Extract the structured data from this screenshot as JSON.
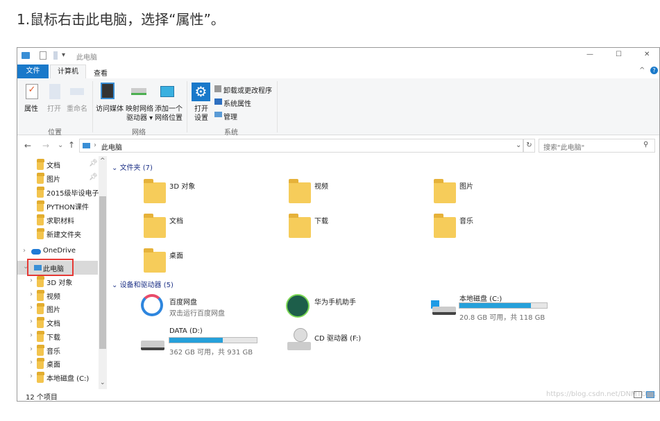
{
  "heading": "1.鼠标右击此电脑，选择“属性”。",
  "window": {
    "title": "此电脑",
    "controls": [
      "—",
      "☐",
      "✕"
    ]
  },
  "tabs": [
    {
      "label": "文件"
    },
    {
      "label": "计算机"
    },
    {
      "label": "查看"
    }
  ],
  "ribbon": {
    "location": {
      "label": "位置",
      "items": [
        "属性",
        "打开",
        "重命名"
      ]
    },
    "network": {
      "label": "网络",
      "items": [
        "访问媒体",
        "映射网络",
        "驱动器 ▾",
        "添加一个",
        "网络位置"
      ]
    },
    "system": {
      "label": "系统",
      "open": "打开",
      "settings": "设置",
      "items": [
        "卸载或更改程序",
        "系统属性",
        "管理"
      ]
    }
  },
  "address": {
    "path": "此电脑",
    "search_placeholder": "搜索\"此电脑\""
  },
  "nav": {
    "quick": [
      "文档",
      "图片",
      "2015级毕设电子",
      "PYTHON课件",
      "求职材料",
      "新建文件夹"
    ],
    "onedrive": "OneDrive",
    "thispc": "此电脑",
    "children": [
      "3D 对象",
      "视频",
      "图片",
      "文档",
      "下载",
      "音乐",
      "桌面",
      "本地磁盘 (C:)"
    ]
  },
  "folders": {
    "header": "文件夹 (7)",
    "items": [
      "3D 对象",
      "视频",
      "图片",
      "文档",
      "下载",
      "音乐",
      "桌面"
    ]
  },
  "devices": {
    "header": "设备和驱动器 (5)",
    "items": [
      {
        "name": "百度网盘",
        "sub": "双击运行百度网盘"
      },
      {
        "name": "华为手机助手"
      },
      {
        "name": "本地磁盘 (C:)",
        "sub": "20.8 GB 可用，共 118 GB",
        "used": 0.82
      },
      {
        "name": "DATA (D:)",
        "sub": "362 GB 可用，共 931 GB",
        "used": 0.61
      },
      {
        "name": "CD 驱动器 (F:)"
      }
    ]
  },
  "status": {
    "count": "12 个项目"
  },
  "watermark": "https://blog.csdn.net/DNMTOOL",
  "colors": {
    "accent": "#1979ca",
    "bar": "#26a0da",
    "select": "#cce8ff"
  }
}
